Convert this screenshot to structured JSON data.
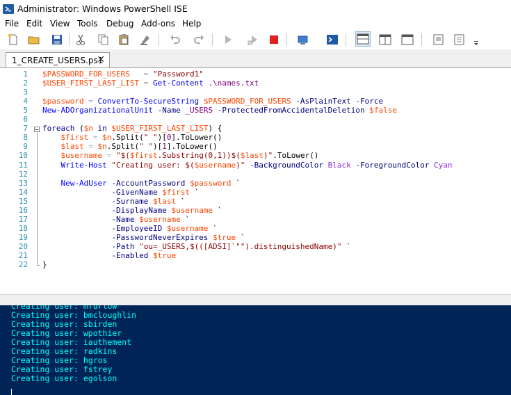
{
  "window": {
    "title": "Administrator: Windows PowerShell ISE",
    "icon": "powershell-icon"
  },
  "menu": [
    "File",
    "Edit",
    "View",
    "Tools",
    "Debug",
    "Add-ons",
    "Help"
  ],
  "toolbar": {
    "buttons": [
      "new-script-icon",
      "open-icon",
      "save-icon",
      "cut-icon",
      "copy-icon",
      "paste-icon",
      "clear-console-icon",
      "undo-icon",
      "redo-icon",
      "run-script-icon",
      "run-selection-icon",
      "stop-icon",
      "new-remote-tab-icon",
      "start-powershell-icon",
      "show-script-top-icon",
      "show-script-right-icon",
      "show-script-maximized-icon",
      "show-script-pane-icon",
      "show-command-addon-icon"
    ]
  },
  "tabs": [
    {
      "label": "1_CREATE_USERS.ps1",
      "close": "✕"
    }
  ],
  "editor": {
    "line_numbers": [
      "1",
      "2",
      "3",
      "4",
      "5",
      "6",
      "7",
      "8",
      "9",
      "10",
      "11",
      "12",
      "13",
      "14",
      "15",
      "16",
      "17",
      "18",
      "19",
      "20",
      "21",
      "22"
    ],
    "lines": [
      [
        [
          "v",
          "$PASSWORD_FOR_USERS"
        ],
        [
          "m",
          "   "
        ],
        [
          "o",
          "="
        ],
        [
          "m",
          " "
        ],
        [
          "s",
          "\"Password1\""
        ]
      ],
      [
        [
          "v",
          "$USER_FIRST_LAST_LIST"
        ],
        [
          "m",
          " "
        ],
        [
          "o",
          "="
        ],
        [
          "m",
          " "
        ],
        [
          "c",
          "Get-Content"
        ],
        [
          "m",
          " "
        ],
        [
          "n",
          ".\\names.txt"
        ]
      ],
      [],
      [
        [
          "v",
          "$password"
        ],
        [
          "m",
          " "
        ],
        [
          "o",
          "="
        ],
        [
          "m",
          " "
        ],
        [
          "c",
          "ConvertTo-SecureString"
        ],
        [
          "m",
          " "
        ],
        [
          "v",
          "$PASSWORD_FOR_USERS"
        ],
        [
          "m",
          " "
        ],
        [
          "p",
          "-AsPlainText"
        ],
        [
          "m",
          " "
        ],
        [
          "p",
          "-Force"
        ]
      ],
      [
        [
          "c",
          "New-ADOrganizationalUnit"
        ],
        [
          "m",
          " "
        ],
        [
          "p",
          "-Name"
        ],
        [
          "m",
          " "
        ],
        [
          "n",
          "_USERS"
        ],
        [
          "m",
          " "
        ],
        [
          "p",
          "-ProtectedFromAccidentalDeletion"
        ],
        [
          "m",
          " "
        ],
        [
          "v",
          "$false"
        ]
      ],
      [],
      [
        [
          "k",
          "foreach"
        ],
        [
          "m",
          " ("
        ],
        [
          "v",
          "$n"
        ],
        [
          "m",
          " "
        ],
        [
          "k",
          "in"
        ],
        [
          "m",
          " "
        ],
        [
          "v",
          "$USER_FIRST_LAST_LIST"
        ],
        [
          "m",
          ") {"
        ]
      ],
      [
        [
          "m",
          "    "
        ],
        [
          "v",
          "$first"
        ],
        [
          "m",
          " "
        ],
        [
          "o",
          "="
        ],
        [
          "m",
          " "
        ],
        [
          "v",
          "$n"
        ],
        [
          "m",
          "."
        ],
        [
          "m",
          "Split"
        ],
        [
          "m",
          "("
        ],
        [
          "s",
          "\" \""
        ],
        [
          "m",
          ")["
        ],
        [
          "n",
          "0"
        ],
        [
          "m",
          "]."
        ],
        [
          "m",
          "ToLower"
        ],
        [
          "m",
          "()"
        ]
      ],
      [
        [
          "m",
          "    "
        ],
        [
          "v",
          "$last"
        ],
        [
          "m",
          " "
        ],
        [
          "o",
          "="
        ],
        [
          "m",
          " "
        ],
        [
          "v",
          "$n"
        ],
        [
          "m",
          "."
        ],
        [
          "m",
          "Split"
        ],
        [
          "m",
          "("
        ],
        [
          "s",
          "\" \""
        ],
        [
          "m",
          ")["
        ],
        [
          "n",
          "1"
        ],
        [
          "m",
          "]."
        ],
        [
          "m",
          "ToLower"
        ],
        [
          "m",
          "()"
        ]
      ],
      [
        [
          "m",
          "    "
        ],
        [
          "v",
          "$username"
        ],
        [
          "m",
          " "
        ],
        [
          "o",
          "="
        ],
        [
          "m",
          " "
        ],
        [
          "s",
          "\"$("
        ],
        [
          "v",
          "$first"
        ],
        [
          "s",
          ".Substring(0,1))$("
        ],
        [
          "v",
          "$last"
        ],
        [
          "s",
          ")\""
        ],
        [
          "m",
          "."
        ],
        [
          "m",
          "ToLower"
        ],
        [
          "m",
          "()"
        ]
      ],
      [
        [
          "m",
          "    "
        ],
        [
          "c",
          "Write-Host"
        ],
        [
          "m",
          " "
        ],
        [
          "s",
          "\"Creating user: $("
        ],
        [
          "v",
          "$username"
        ],
        [
          "s",
          ")\""
        ],
        [
          "m",
          " "
        ],
        [
          "p",
          "-BackgroundColor"
        ],
        [
          "m",
          " "
        ],
        [
          "a",
          "Black"
        ],
        [
          "m",
          " "
        ],
        [
          "p",
          "-ForegroundColor"
        ],
        [
          "m",
          " "
        ],
        [
          "a",
          "Cyan"
        ]
      ],
      [],
      [
        [
          "m",
          "    "
        ],
        [
          "c",
          "New-AdUser"
        ],
        [
          "m",
          " "
        ],
        [
          "p",
          "-AccountPassword"
        ],
        [
          "m",
          " "
        ],
        [
          "v",
          "$password"
        ],
        [
          "m",
          " `"
        ]
      ],
      [
        [
          "m",
          "               "
        ],
        [
          "p",
          "-GivenName"
        ],
        [
          "m",
          " "
        ],
        [
          "v",
          "$first"
        ],
        [
          "m",
          " `"
        ]
      ],
      [
        [
          "m",
          "               "
        ],
        [
          "p",
          "-Surname"
        ],
        [
          "m",
          " "
        ],
        [
          "v",
          "$last"
        ],
        [
          "m",
          " `"
        ]
      ],
      [
        [
          "m",
          "               "
        ],
        [
          "p",
          "-DisplayName"
        ],
        [
          "m",
          " "
        ],
        [
          "v",
          "$username"
        ],
        [
          "m",
          " `"
        ]
      ],
      [
        [
          "m",
          "               "
        ],
        [
          "p",
          "-Name"
        ],
        [
          "m",
          " "
        ],
        [
          "v",
          "$username"
        ],
        [
          "m",
          " `"
        ]
      ],
      [
        [
          "m",
          "               "
        ],
        [
          "p",
          "-EmployeeID"
        ],
        [
          "m",
          " "
        ],
        [
          "v",
          "$username"
        ],
        [
          "m",
          " `"
        ]
      ],
      [
        [
          "m",
          "               "
        ],
        [
          "p",
          "-PasswordNeverExpires"
        ],
        [
          "m",
          " "
        ],
        [
          "v",
          "$true"
        ],
        [
          "m",
          " `"
        ]
      ],
      [
        [
          "m",
          "               "
        ],
        [
          "p",
          "-Path"
        ],
        [
          "m",
          " "
        ],
        [
          "s",
          "\"ou=_USERS,$(([ADSI]`\"\").distinguishedName)\""
        ],
        [
          "m",
          " `"
        ]
      ],
      [
        [
          "m",
          "               "
        ],
        [
          "p",
          "-Enabled"
        ],
        [
          "m",
          " "
        ],
        [
          "v",
          "$true"
        ]
      ],
      [
        [
          "m",
          "}"
        ]
      ]
    ]
  },
  "console": {
    "lines": [
      "Creating user: mfurlow",
      "Creating user: bmcloughlin",
      "Creating user: sbirden",
      "Creating user: wpothier",
      "Creating user: iauthement",
      "Creating user: radkins",
      "Creating user: hgros",
      "Creating user: fstrey",
      "Creating user: egolson"
    ]
  },
  "colors": {
    "console_bg": "#012456",
    "console_text": "#00ffff",
    "line_number": "#2b91af",
    "variable": "#ff4500",
    "string": "#8b0000",
    "command": "#0000ff",
    "parameter": "#000080",
    "keyword": "#00008b",
    "type": "#008080"
  }
}
